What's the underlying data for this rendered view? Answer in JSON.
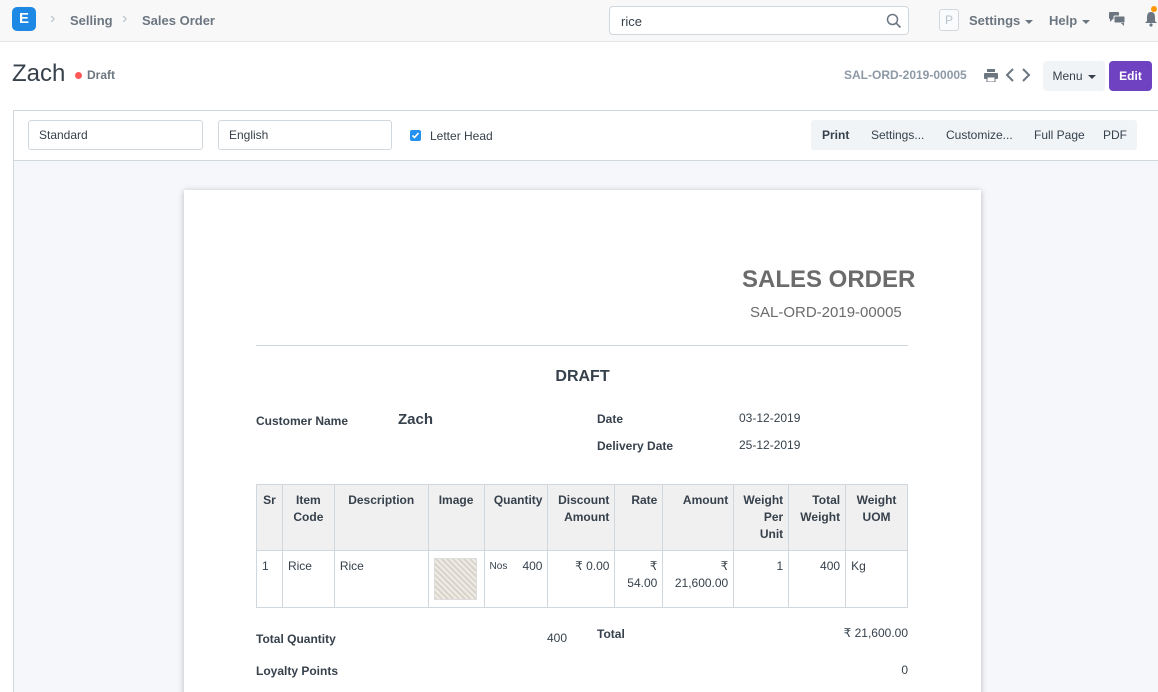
{
  "navbar": {
    "logo_letter": "E",
    "breadcrumbs": [
      "Selling",
      "Sales Order"
    ],
    "search_value": "rice",
    "avatar_letter": "P",
    "settings_label": "Settings",
    "help_label": "Help"
  },
  "page_head": {
    "title": "Zach",
    "status": "Draft",
    "docname": "SAL-ORD-2019-00005",
    "menu_label": "Menu",
    "edit_label": "Edit"
  },
  "toolbar": {
    "format_value": "Standard",
    "language_value": "English",
    "letter_head_label": "Letter Head",
    "letter_head_checked": true,
    "buttons": [
      "Print",
      "Settings...",
      "Customize...",
      "Full Page",
      "PDF"
    ]
  },
  "sheet": {
    "title": "SALES ORDER",
    "number": "SAL-ORD-2019-00005",
    "draft_banner": "DRAFT",
    "customer_name_label": "Customer Name",
    "customer_name": "Zach",
    "date_label": "Date",
    "date": "03-12-2019",
    "delivery_date_label": "Delivery Date",
    "delivery_date": "25-12-2019",
    "table": {
      "headers": [
        "Sr",
        "Item Code",
        "Description",
        "Image",
        "Quantity",
        "Discount Amount",
        "Rate",
        "Amount",
        "Weight Per Unit",
        "Total Weight",
        "Weight UOM"
      ],
      "rows": [
        {
          "sr": "1",
          "item_code": "Rice",
          "description": "Rice",
          "uom": "Nos",
          "quantity": "400",
          "discount": "₹ 0.00",
          "rate_symbol": "₹",
          "rate": "54.00",
          "amount_symbol": "₹",
          "amount": "21,600.00",
          "weight_per_unit": "1",
          "total_weight": "400",
          "weight_uom": "Kg"
        }
      ]
    },
    "total_quantity_label": "Total Quantity",
    "total_quantity": "400",
    "total_label": "Total",
    "total": "₹ 21,600.00",
    "loyalty_label": "Loyalty Points",
    "loyalty": "0"
  }
}
